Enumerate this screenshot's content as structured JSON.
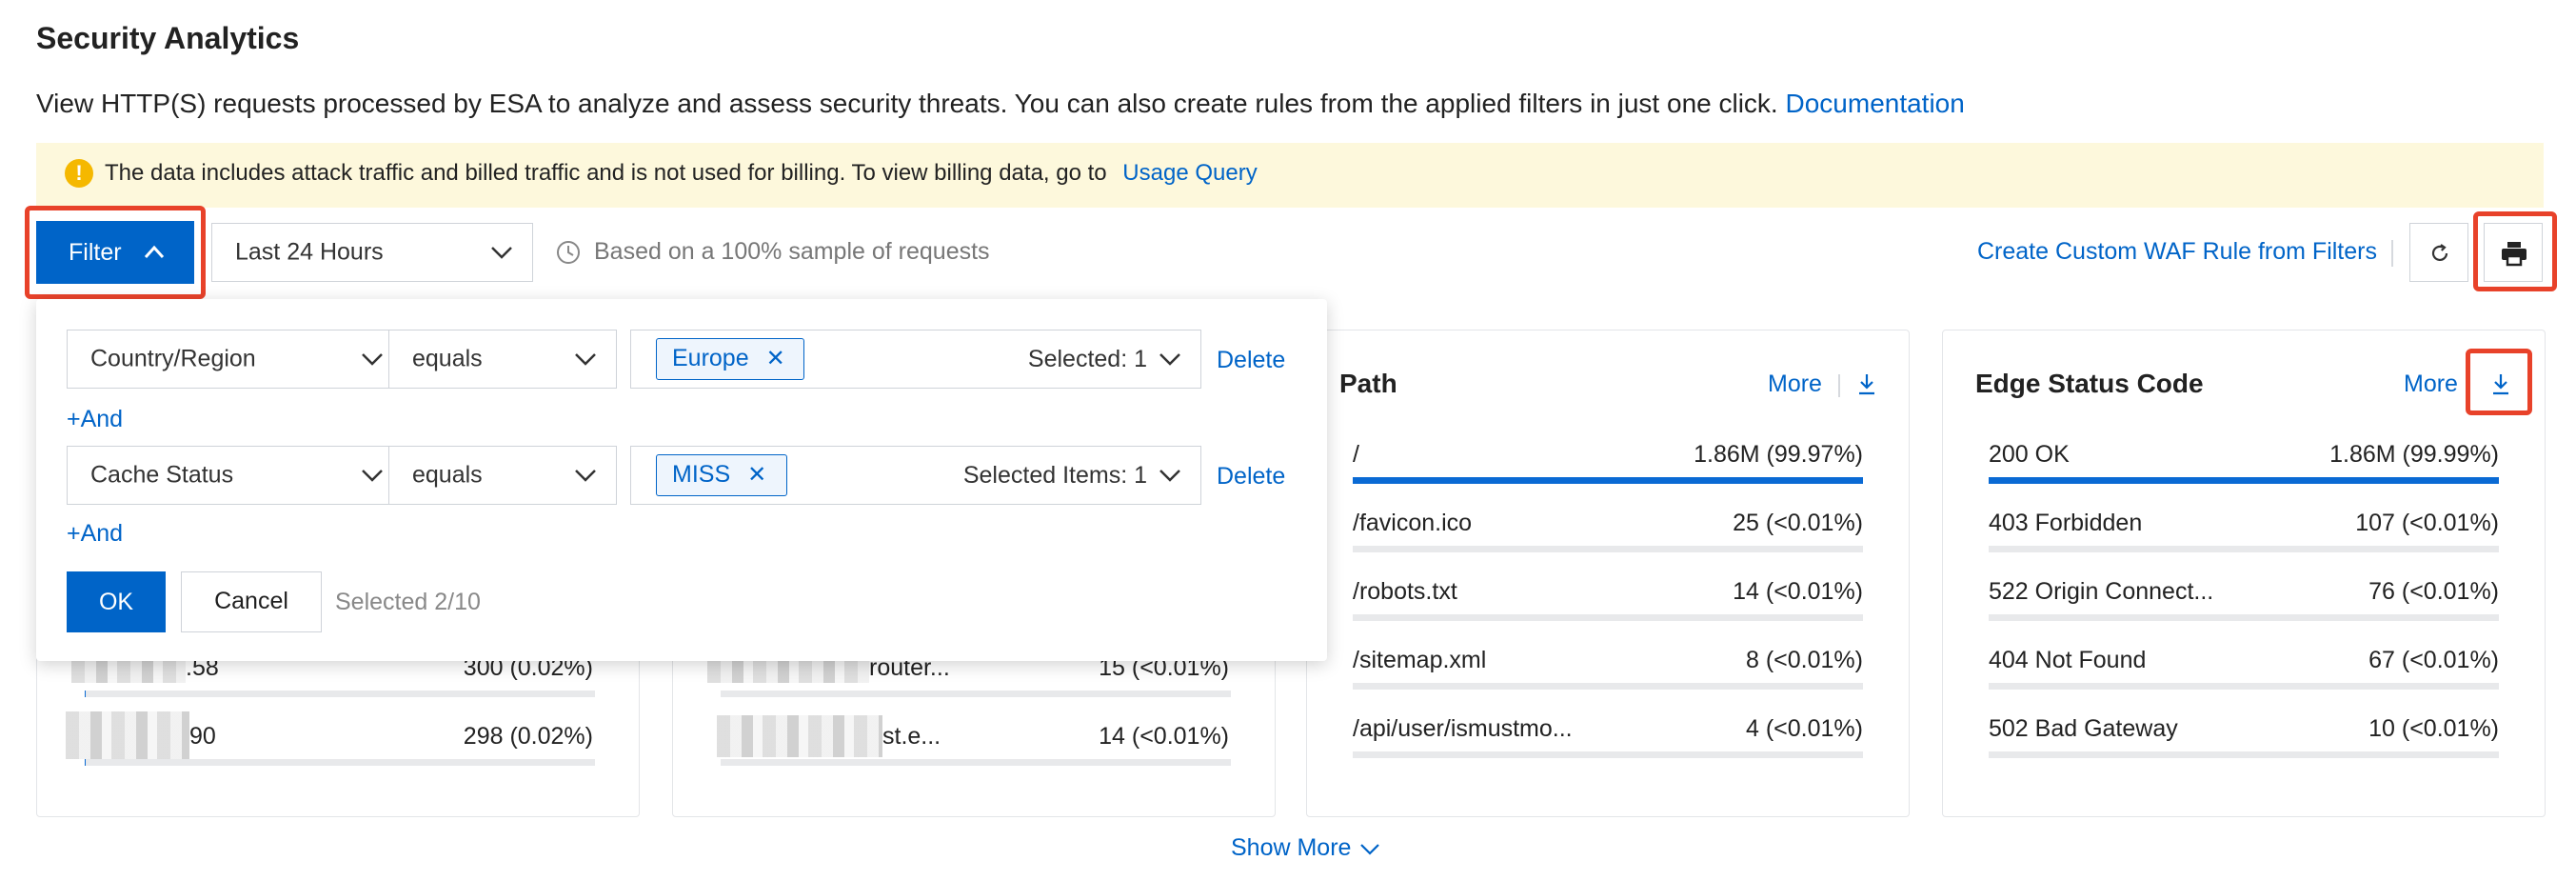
{
  "header": {
    "title": "Security Analytics",
    "description": "View HTTP(S) requests processed by ESA to analyze and assess security threats. You can also create rules from the applied filters in just one click.",
    "doc_link": "Documentation"
  },
  "notice": {
    "text": "The data includes attack traffic and billed traffic and is not used for billing. To view billing data, go to",
    "link": "Usage Query"
  },
  "toolbar": {
    "filter_label": "Filter",
    "time_range": "Last 24 Hours",
    "sample_note": "Based on a 100% sample of requests",
    "waf_rule_link": "Create Custom WAF Rule from Filters"
  },
  "filter_panel": {
    "conditions": [
      {
        "field": "Country/Region",
        "operator": "equals",
        "tag": "Europe",
        "count_text": "Selected: 1",
        "delete_label": "Delete"
      },
      {
        "field": "Cache Status",
        "operator": "equals",
        "tag": "MISS",
        "count_text": "Selected Items: 1",
        "delete_label": "Delete"
      }
    ],
    "add_and_label": "+And",
    "ok_label": "OK",
    "cancel_label": "Cancel",
    "selected_summary": "Selected 2/10"
  },
  "cards": {
    "card1_rows": [
      {
        "label": ".58",
        "value": "300 (0.02%)",
        "fraction": 0.0002
      },
      {
        "label": "90",
        "value": "298 (0.02%)",
        "fraction": 0.0002
      }
    ],
    "card2_rows": [
      {
        "label": "router...",
        "value": "15 (<0.01%)",
        "fraction": 0.0001
      },
      {
        "label": "st.e...",
        "value": "14 (<0.01%)",
        "fraction": 0.0001
      }
    ],
    "path": {
      "title": "Path",
      "more_label": "More",
      "rows": [
        {
          "label": "/",
          "value": "1.86M (99.97%)",
          "fraction": 0.9997
        },
        {
          "label": "/favicon.ico",
          "value": "25 (<0.01%)",
          "fraction": 0.0001
        },
        {
          "label": "/robots.txt",
          "value": "14 (<0.01%)",
          "fraction": 0.0001
        },
        {
          "label": "/sitemap.xml",
          "value": "8 (<0.01%)",
          "fraction": 0.0001
        },
        {
          "label": "/api/user/ismustmo...",
          "value": "4 (<0.01%)",
          "fraction": 0.0001
        }
      ]
    },
    "edge_status": {
      "title": "Edge Status Code",
      "more_label": "More",
      "rows": [
        {
          "label": "200 OK",
          "value": "1.86M (99.99%)",
          "fraction": 0.9999
        },
        {
          "label": "403 Forbidden",
          "value": "107 (<0.01%)",
          "fraction": 0.0001
        },
        {
          "label": "522 Origin Connect...",
          "value": "76 (<0.01%)",
          "fraction": 0.0001
        },
        {
          "label": "404 Not Found",
          "value": "67 (<0.01%)",
          "fraction": 0.0001
        },
        {
          "label": "502 Bad Gateway",
          "value": "10 (<0.01%)",
          "fraction": 0.0001
        }
      ]
    }
  },
  "show_more_label": "Show More",
  "colors": {
    "accent": "#0064c8",
    "highlight": "#e8422a",
    "notice_bg": "#fdf8dc"
  }
}
